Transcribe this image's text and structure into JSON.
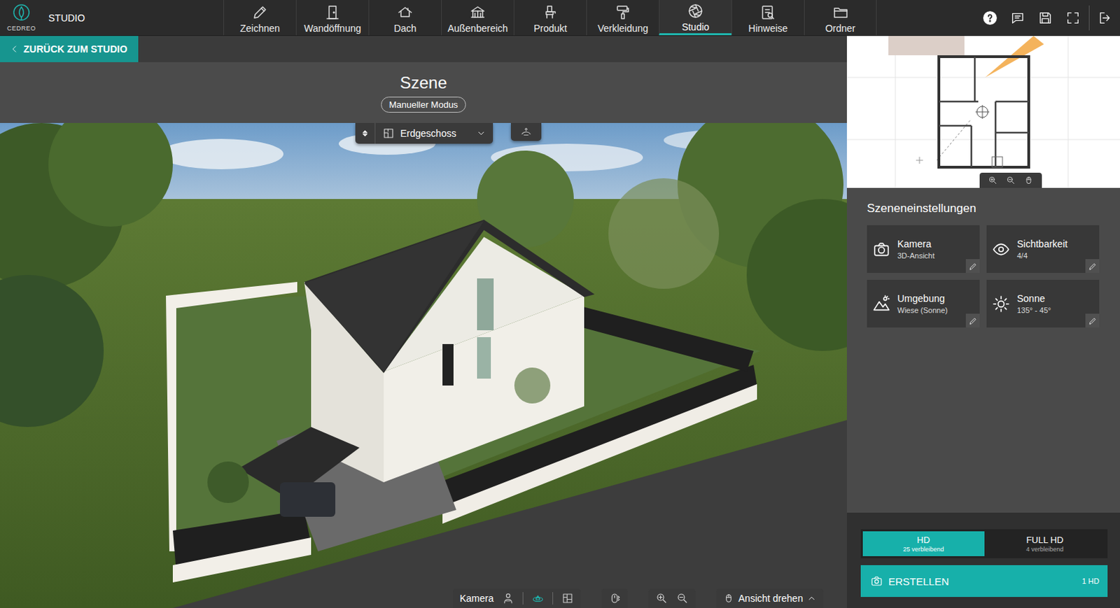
{
  "app": {
    "logo": "CEDREO",
    "product": "STUDIO"
  },
  "menu": [
    {
      "label": "Zeichnen",
      "selected": false,
      "kind": "pencil"
    },
    {
      "label": "Wandöffnung",
      "selected": false,
      "kind": "door"
    },
    {
      "label": "Dach",
      "selected": false,
      "kind": "roof"
    },
    {
      "label": "Außenbereich",
      "selected": false,
      "kind": "outdoor"
    },
    {
      "label": "Produkt",
      "selected": false,
      "kind": "product"
    },
    {
      "label": "Verkleidung",
      "selected": false,
      "kind": "brush"
    },
    {
      "label": "Studio",
      "selected": true,
      "kind": "aperture"
    },
    {
      "label": "Hinweise",
      "selected": false,
      "kind": "notes"
    },
    {
      "label": "Ordner",
      "selected": false,
      "kind": "folder"
    }
  ],
  "back_button": {
    "label": "ZURÜCK ZUM STUDIO"
  },
  "scene": {
    "title": "Szene",
    "mode": "Manueller Modus"
  },
  "floor_selector": {
    "value": "Erdgeschoss"
  },
  "viewport_toolbar": {
    "camera_label": "Kamera",
    "view_modes": [
      {
        "kind": "person",
        "selected": false
      },
      {
        "kind": "orbit",
        "selected": true
      },
      {
        "kind": "plan",
        "selected": false
      }
    ],
    "rotate_label": "Ansicht drehen"
  },
  "settings": {
    "title": "Szeneneinstellungen",
    "cards": [
      {
        "title": "Kamera",
        "value": "3D-Ansicht",
        "kind": "camera"
      },
      {
        "title": "Sichtbarkeit",
        "value": "4/4",
        "kind": "eye"
      },
      {
        "title": "Umgebung",
        "value": "Wiese (Sonne)",
        "kind": "landscape"
      },
      {
        "title": "Sonne",
        "value": "135° - 45°",
        "kind": "sun"
      }
    ]
  },
  "quality": [
    {
      "label": "HD",
      "remaining": "25 verbleibend",
      "selected": true
    },
    {
      "label": "FULL HD",
      "remaining": "4 verbleibend",
      "selected": false
    }
  ],
  "create": {
    "label": "ERSTELLEN",
    "cost": "1 HD"
  }
}
